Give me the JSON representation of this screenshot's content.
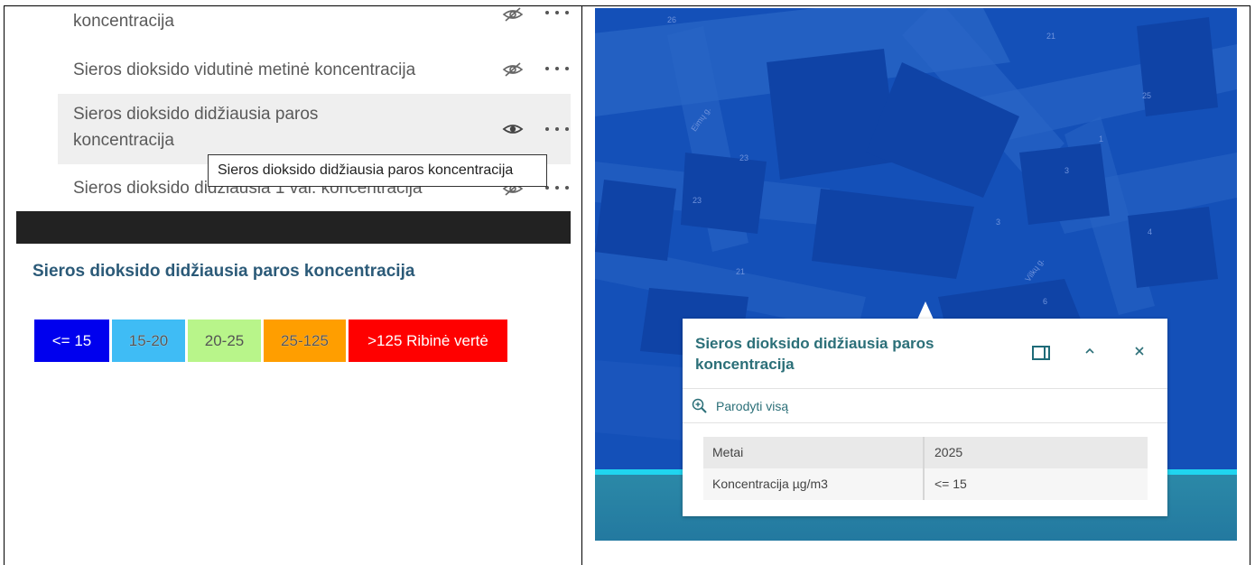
{
  "layer_list": {
    "items": [
      {
        "label": "koncentracija",
        "visible": false
      },
      {
        "label": "Sieros dioksido vidutinė metinė koncentracija",
        "visible": false
      },
      {
        "label_line1": "Sieros dioksido didžiausia paros",
        "label_line2": "koncentracija",
        "visible": true
      },
      {
        "label": "Sieros dioksido didžiausia 1 val. koncentracija",
        "visible": false
      }
    ],
    "tooltip": "Sieros dioksido didžiausia paros koncentracija"
  },
  "legend": {
    "title": "Sieros dioksido didžiausia paros koncentracija",
    "classes": [
      {
        "label": "<= 15",
        "color": "#0000ee"
      },
      {
        "label": "15-20",
        "color": "#3fbcf5"
      },
      {
        "label": "20-25",
        "color": "#b8f58a"
      },
      {
        "label": "25-125",
        "color": "#ff9e00"
      },
      {
        "label": ">125 Ribinė vertė",
        "color": "#ff0000"
      }
    ]
  },
  "map": {
    "labels": [
      "26",
      "21",
      "25",
      "Eimų g.",
      "23",
      "23",
      "1",
      "3",
      "3",
      "4",
      "21",
      "Vilkų g.",
      "6"
    ]
  },
  "popup": {
    "title": "Sieros dioksido didžiausia paros koncentracija",
    "zoom_label": "Parodyti visą",
    "attributes": [
      {
        "key": "Metai",
        "value": "2025"
      },
      {
        "key": "Koncentracija µg/m3",
        "value": "<= 15"
      }
    ]
  }
}
